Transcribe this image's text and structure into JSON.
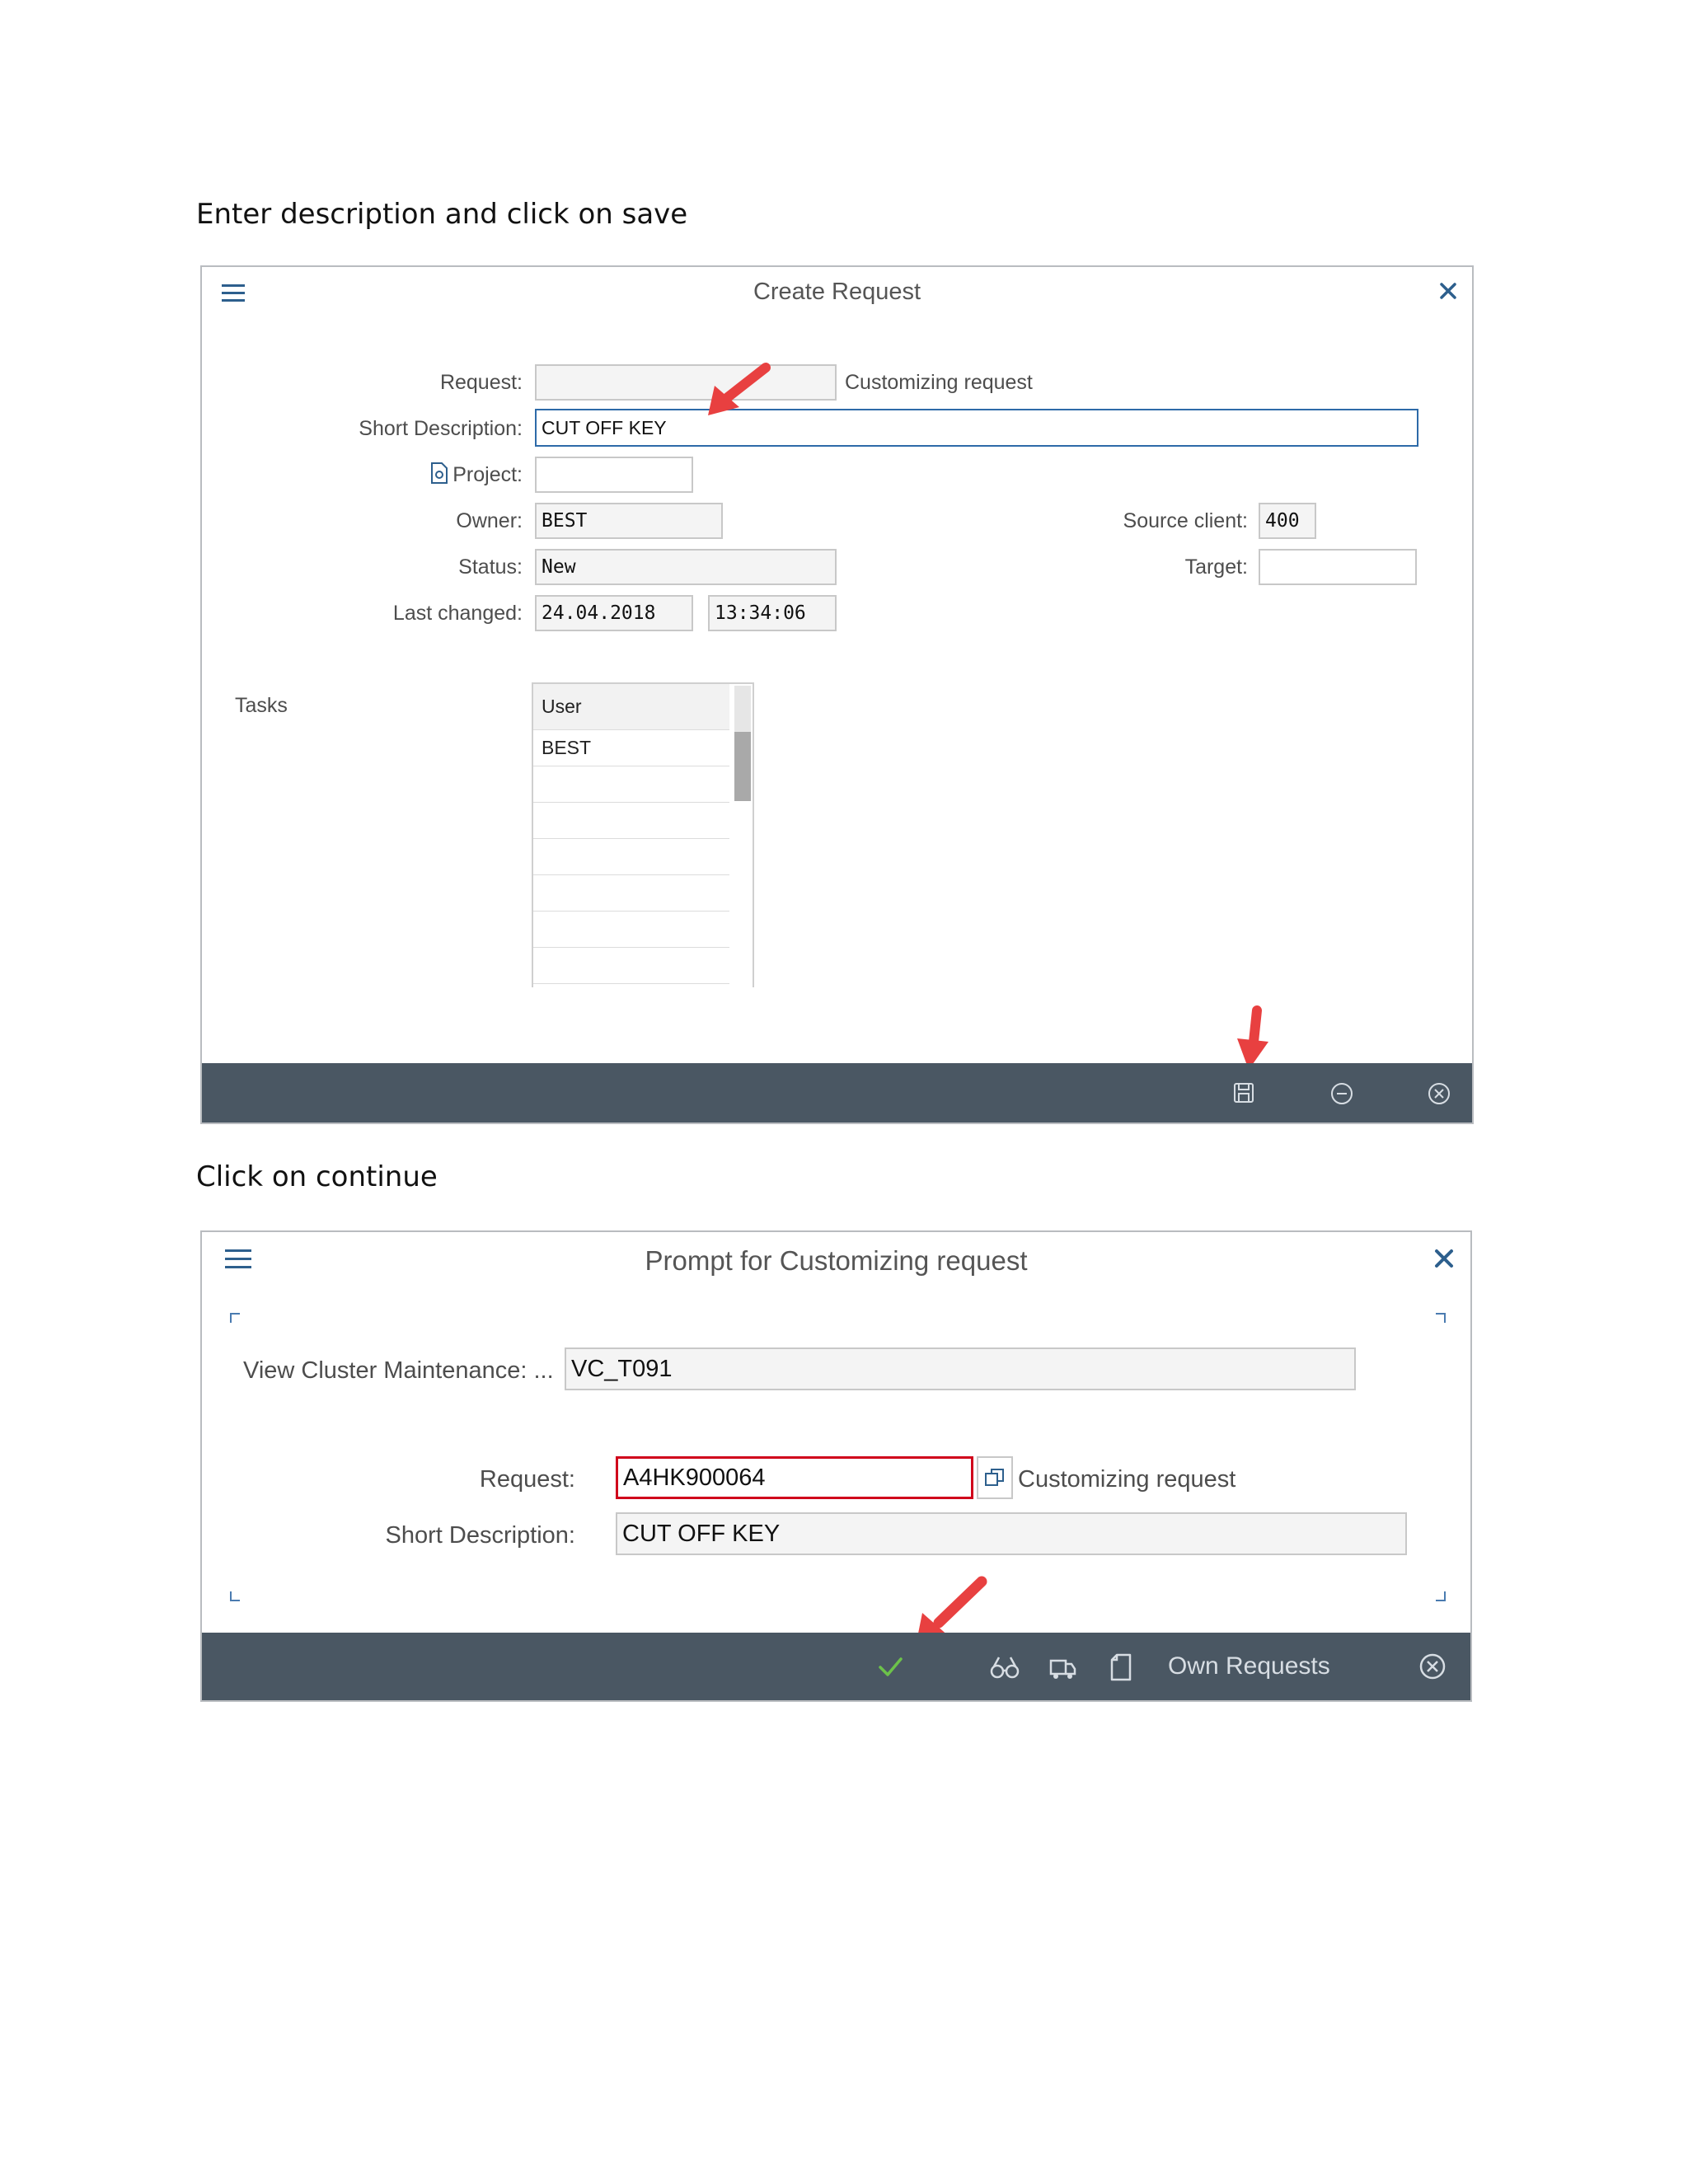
{
  "step1": {
    "caption": "Enter description and click on save",
    "dialog_title": "Create Request",
    "fields": {
      "request_label": "Request:",
      "request_value": "",
      "request_type": "Customizing request",
      "short_desc_label": "Short Description:",
      "short_desc_value": "CUT OFF KEY",
      "project_label": "Project:",
      "project_value": "",
      "owner_label": "Owner:",
      "owner_value": "BEST",
      "status_label": "Status:",
      "status_value": "New",
      "last_changed_label": "Last changed:",
      "last_changed_date": "24.04.2018",
      "last_changed_time": "13:34:06",
      "source_client_label": "Source client:",
      "source_client_value": "400",
      "target_label": "Target:",
      "target_value": ""
    },
    "tasks_label": "Tasks",
    "tasks_table": {
      "header": "User",
      "rows": [
        "BEST",
        "",
        "",
        "",
        "",
        "",
        ""
      ]
    },
    "footer_icons": [
      "save-icon",
      "minus-circle-icon",
      "cancel-circle-icon"
    ]
  },
  "step2": {
    "caption": "Click on continue",
    "dialog_title": "Prompt for Customizing request",
    "view_cluster_label": "View Cluster Maintenance: ...",
    "view_cluster_value": "VC_T091",
    "request_label": "Request:",
    "request_value": "A4HK900064",
    "request_type": "Customizing request",
    "short_desc_label": "Short Description:",
    "short_desc_value": "CUT OFF KEY",
    "own_requests_label": "Own Requests",
    "footer_icons": [
      "check-icon",
      "binoculars-icon",
      "transport-icon",
      "new-document-icon",
      "cancel-circle-icon"
    ]
  },
  "colors": {
    "footer": "#4a5763",
    "arrow": "#e84040",
    "check": "#6cc24a",
    "required_border": "#d0021b",
    "focus_border": "#2d6aa8"
  }
}
